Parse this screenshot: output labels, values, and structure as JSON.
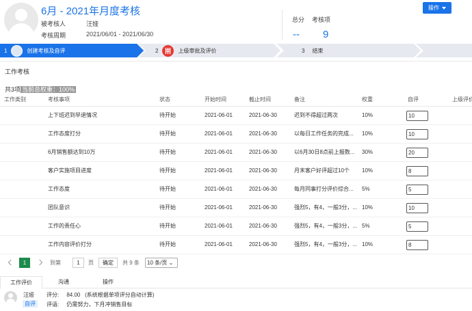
{
  "header": {
    "title": "6月 - 2021年月度考核",
    "assessee_label": "被考核人",
    "assessee_value": "汪娅",
    "period_label": "考核周期",
    "period_value": "2021/06/01 - 2021/06/30",
    "total_label": "总分",
    "total_value": "--",
    "items_label": "考核项",
    "items_value": "9",
    "action_button": "操作"
  },
  "steps": [
    {
      "num": "1",
      "label": "创建考核及自评"
    },
    {
      "num": "2",
      "label": "上级审批及评价"
    },
    {
      "num": "3",
      "label": "结束"
    }
  ],
  "section": {
    "title": "工作考核",
    "count_text": "共3项",
    "weight_text": "当前总权重：100%"
  },
  "table": {
    "columns": [
      "工作类别",
      "考核事项",
      "状态",
      "开始时间",
      "截止时间",
      "备注",
      "权重",
      "自评",
      "上级评价"
    ],
    "rows": [
      {
        "item": "上下班迟到早退情况",
        "status": "待开始",
        "start": "2021-06-01",
        "end": "2021-06-30",
        "note": "迟到不得超过两次",
        "weight": "10%",
        "self": "10"
      },
      {
        "item": "工作态度打分",
        "status": "待开始",
        "start": "2021-06-01",
        "end": "2021-06-30",
        "note": "以每日工作任务的完成...",
        "weight": "10%",
        "self": "10"
      },
      {
        "item": "6月销售额达到10万",
        "status": "待开始",
        "start": "2021-06-01",
        "end": "2021-06-30",
        "note": "以6月30日8点前上报数...",
        "weight": "30%",
        "self": "20"
      },
      {
        "item": "客户实施项目进度",
        "status": "待开始",
        "start": "2021-06-01",
        "end": "2021-06-30",
        "note": "月末客户好评超过10个",
        "weight": "10%",
        "self": "8"
      },
      {
        "item": "工作态度",
        "status": "待开始",
        "start": "2021-06-01",
        "end": "2021-06-30",
        "note": "每月同事打分评价综合...",
        "weight": "5%",
        "self": "5"
      },
      {
        "item": "团队意识",
        "status": "待开始",
        "start": "2021-06-01",
        "end": "2021-06-30",
        "note": "强烈5，有4，一般3分，...",
        "weight": "10%",
        "self": "10"
      },
      {
        "item": "工作的责任心",
        "status": "待开始",
        "start": "2021-06-01",
        "end": "2021-06-30",
        "note": "强烈5，有4，一般3分，...",
        "weight": "5%",
        "self": "5"
      },
      {
        "item": "工作内容评价打分",
        "status": "待开始",
        "start": "2021-06-01",
        "end": "2021-06-30",
        "note": "强烈5，有4，一般3分，...",
        "weight": "10%",
        "self": "8"
      }
    ]
  },
  "pager": {
    "current": "1",
    "goto_label": "到第",
    "goto_value": "1",
    "page_unit": "页",
    "confirm": "确定",
    "total": "共 9 条",
    "page_size": "10 条/页"
  },
  "tabs": [
    "工作评价",
    "沟通",
    "操作"
  ],
  "comment": {
    "name": "汪娅",
    "tag": "自评",
    "score_label": "评分:",
    "score_value": "84.00",
    "score_note": "(系统根据单项评分自动计算)",
    "remark_label": "评语:",
    "remark_value": "仍需努力，下月冲销售目标"
  }
}
